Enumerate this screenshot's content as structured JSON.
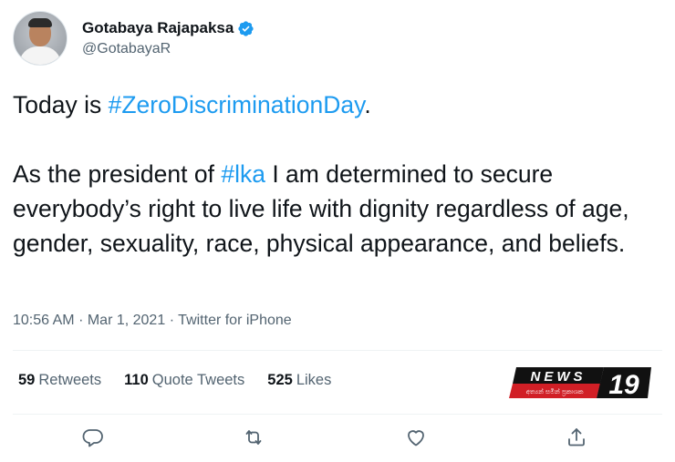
{
  "user": {
    "display_name": "Gotabaya Rajapaksa",
    "handle": "@GotabayaR",
    "verified": true
  },
  "tweet": {
    "line1_prefix": "Today is ",
    "line1_hashtag": "#ZeroDiscriminationDay",
    "line1_suffix": ".",
    "para2_prefix": "As the president of ",
    "para2_hashtag": "#lka",
    "para2_rest": " I am determined to secure everybody’s right to live life with dignity regardless of age, gender, sexuality, race, physical appearance, and beliefs."
  },
  "meta": {
    "time": "10:56 AM",
    "date": "Mar 1, 2021",
    "source": "Twitter for iPhone"
  },
  "stats": {
    "retweets_count": "59",
    "retweets_label": "Retweets",
    "quotes_count": "110",
    "quotes_label": "Quote Tweets",
    "likes_count": "525",
    "likes_label": "Likes"
  },
  "watermark": {
    "brand": "NEWS",
    "number": "19",
    "tagline": "අත්‍යන් සමින් ප්‍රකාශක"
  },
  "colors": {
    "text": "#0f1419",
    "secondary": "#536471",
    "link": "#1d9bf0",
    "verified_badge": "#1d9bf0",
    "watermark_red": "#d11f26"
  },
  "icons": {
    "reply": "reply-icon",
    "retweet": "retweet-icon",
    "like": "heart-icon",
    "share": "share-icon"
  }
}
